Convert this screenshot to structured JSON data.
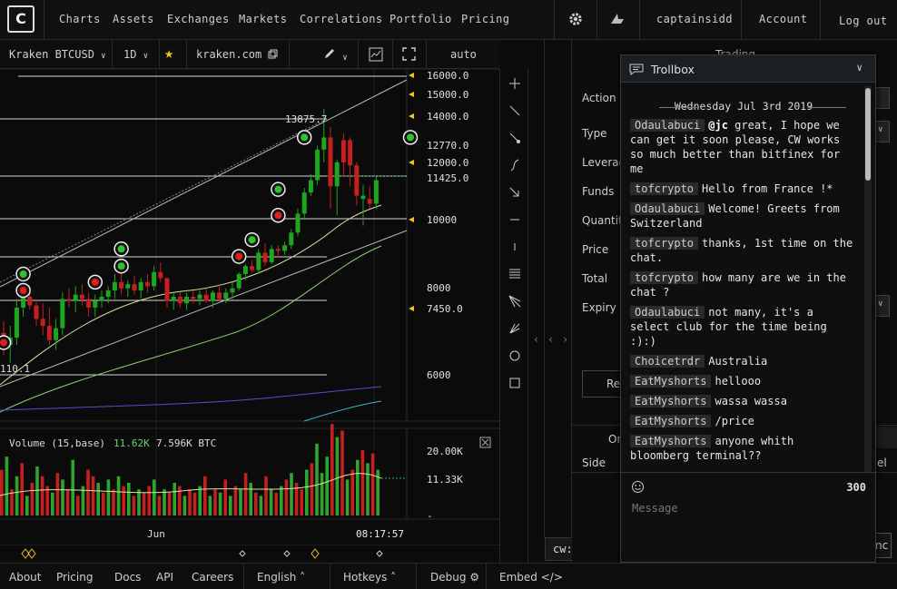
{
  "nav": {
    "logo": "C",
    "links": [
      "Charts",
      "Assets",
      "Exchanges",
      "Markets",
      "Correlations",
      "Portfolio",
      "Pricing"
    ],
    "settings_icon": "gear-icon",
    "alert_icon": "shark-icon",
    "username": "captainsidd",
    "account": "Account",
    "logout": "Log out"
  },
  "chart_toolbar": {
    "market": "Kraken BTCUSD",
    "interval": "1D",
    "source": "kraken.com",
    "scale_mode": "auto"
  },
  "chart_data": [
    {
      "type": "candlestick",
      "title": "",
      "price_labels": [
        "16000.0",
        "15000.0",
        "14000.0",
        "12770.0",
        "12000.0",
        "11425.0",
        "10000",
        "8000",
        "7450.0",
        "6000"
      ],
      "annotations": [
        "13875.7",
        "110.1"
      ],
      "x_tick": "Jun",
      "time": "08:17:57",
      "candles": [
        {
          "o": 7150,
          "h": 7400,
          "l": 6700,
          "c": 6900,
          "up": false
        },
        {
          "o": 6900,
          "h": 7300,
          "l": 6550,
          "c": 7050,
          "up": true
        },
        {
          "o": 7050,
          "h": 7900,
          "l": 6900,
          "c": 7700,
          "up": true
        },
        {
          "o": 7700,
          "h": 8250,
          "l": 7500,
          "c": 7950,
          "up": true
        },
        {
          "o": 7950,
          "h": 8200,
          "l": 7650,
          "c": 7750,
          "up": false
        },
        {
          "o": 7750,
          "h": 7900,
          "l": 7300,
          "c": 7450,
          "up": false
        },
        {
          "o": 7450,
          "h": 7800,
          "l": 7100,
          "c": 7300,
          "up": false
        },
        {
          "o": 7300,
          "h": 7700,
          "l": 6900,
          "c": 7000,
          "up": false
        },
        {
          "o": 7000,
          "h": 7450,
          "l": 6800,
          "c": 7250,
          "up": true
        },
        {
          "o": 7250,
          "h": 8050,
          "l": 7100,
          "c": 7900,
          "up": true
        },
        {
          "o": 7900,
          "h": 8150,
          "l": 7700,
          "c": 7850,
          "up": false
        },
        {
          "o": 7850,
          "h": 8200,
          "l": 7600,
          "c": 8000,
          "up": true
        },
        {
          "o": 8000,
          "h": 8250,
          "l": 7750,
          "c": 7900,
          "up": false
        },
        {
          "o": 7900,
          "h": 8050,
          "l": 7500,
          "c": 7700,
          "up": false
        },
        {
          "o": 7700,
          "h": 8000,
          "l": 7500,
          "c": 7850,
          "up": true
        },
        {
          "o": 7850,
          "h": 8100,
          "l": 7700,
          "c": 7950,
          "up": true
        },
        {
          "o": 7950,
          "h": 8200,
          "l": 7800,
          "c": 8100,
          "up": true
        },
        {
          "o": 8100,
          "h": 8500,
          "l": 7900,
          "c": 8300,
          "up": true
        },
        {
          "o": 8300,
          "h": 8600,
          "l": 8000,
          "c": 8150,
          "up": false
        },
        {
          "o": 8150,
          "h": 8350,
          "l": 7950,
          "c": 8250,
          "up": true
        },
        {
          "o": 8250,
          "h": 8450,
          "l": 8000,
          "c": 8100,
          "up": false
        },
        {
          "o": 8100,
          "h": 8400,
          "l": 7900,
          "c": 8300,
          "up": true
        },
        {
          "o": 8300,
          "h": 8500,
          "l": 8050,
          "c": 8200,
          "up": false
        },
        {
          "o": 8200,
          "h": 8700,
          "l": 8100,
          "c": 8550,
          "up": true
        },
        {
          "o": 8550,
          "h": 8800,
          "l": 8300,
          "c": 8400,
          "up": false
        },
        {
          "o": 8400,
          "h": 8400,
          "l": 7700,
          "c": 7850,
          "up": false
        },
        {
          "o": 7850,
          "h": 8050,
          "l": 7650,
          "c": 7950,
          "up": true
        },
        {
          "o": 7950,
          "h": 8050,
          "l": 7700,
          "c": 7800,
          "up": false
        },
        {
          "o": 7800,
          "h": 8050,
          "l": 7650,
          "c": 7950,
          "up": true
        },
        {
          "o": 7950,
          "h": 8100,
          "l": 7800,
          "c": 7900,
          "up": false
        },
        {
          "o": 7900,
          "h": 8100,
          "l": 7750,
          "c": 8000,
          "up": true
        },
        {
          "o": 8000,
          "h": 8150,
          "l": 7800,
          "c": 7850,
          "up": false
        },
        {
          "o": 7850,
          "h": 8100,
          "l": 7700,
          "c": 8050,
          "up": true
        },
        {
          "o": 8050,
          "h": 8250,
          "l": 7850,
          "c": 7900,
          "up": false
        },
        {
          "o": 7900,
          "h": 8150,
          "l": 7800,
          "c": 8050,
          "up": true
        },
        {
          "o": 8050,
          "h": 8300,
          "l": 7900,
          "c": 8150,
          "up": true
        },
        {
          "o": 8150,
          "h": 8550,
          "l": 8100,
          "c": 8500,
          "up": true
        },
        {
          "o": 8500,
          "h": 8750,
          "l": 8350,
          "c": 8700,
          "up": true
        },
        {
          "o": 8700,
          "h": 8850,
          "l": 8550,
          "c": 8600,
          "up": false
        },
        {
          "o": 8600,
          "h": 9150,
          "l": 8500,
          "c": 9050,
          "up": true
        },
        {
          "o": 9050,
          "h": 9300,
          "l": 8700,
          "c": 8800,
          "up": false
        },
        {
          "o": 8800,
          "h": 9250,
          "l": 8750,
          "c": 9150,
          "up": true
        },
        {
          "o": 9150,
          "h": 9250,
          "l": 8900,
          "c": 9100,
          "up": false
        },
        {
          "o": 9100,
          "h": 9350,
          "l": 9000,
          "c": 9250,
          "up": true
        },
        {
          "o": 9250,
          "h": 9700,
          "l": 9150,
          "c": 9600,
          "up": true
        },
        {
          "o": 9600,
          "h": 10300,
          "l": 9500,
          "c": 10150,
          "up": true
        },
        {
          "o": 10150,
          "h": 10950,
          "l": 10000,
          "c": 10800,
          "up": true
        },
        {
          "o": 10800,
          "h": 11400,
          "l": 10700,
          "c": 11200,
          "up": true
        },
        {
          "o": 11200,
          "h": 12400,
          "l": 11050,
          "c": 12250,
          "up": true
        },
        {
          "o": 12250,
          "h": 13800,
          "l": 11800,
          "c": 12700,
          "up": true
        },
        {
          "o": 12700,
          "h": 13100,
          "l": 10300,
          "c": 11000,
          "up": false
        },
        {
          "o": 11000,
          "h": 11900,
          "l": 10100,
          "c": 11800,
          "up": true
        },
        {
          "o": 11800,
          "h": 12850,
          "l": 11300,
          "c": 12600,
          "up": false
        },
        {
          "o": 12600,
          "h": 12700,
          "l": 11000,
          "c": 11700,
          "up": false
        },
        {
          "o": 11700,
          "h": 11800,
          "l": 10400,
          "c": 10700,
          "up": false
        },
        {
          "o": 10700,
          "h": 11050,
          "l": 9800,
          "c": 10600,
          "up": true
        },
        {
          "o": 10600,
          "h": 11000,
          "l": 10300,
          "c": 10450,
          "up": false
        },
        {
          "o": 10450,
          "h": 11300,
          "l": 10300,
          "c": 11200,
          "up": true
        }
      ],
      "markers": [
        {
          "i": 0,
          "p": 6950,
          "kind": "sell"
        },
        {
          "i": 3,
          "p": 8100,
          "kind": "sell"
        },
        {
          "i": 3,
          "p": 8500,
          "kind": "buy"
        },
        {
          "i": 14,
          "p": 8300,
          "kind": "sell"
        },
        {
          "i": 18,
          "p": 9150,
          "kind": "buy"
        },
        {
          "i": 18,
          "p": 8700,
          "kind": "buy"
        },
        {
          "i": 36,
          "p": 8950,
          "kind": "sell"
        },
        {
          "i": 38,
          "p": 9400,
          "kind": "buy"
        },
        {
          "i": 42,
          "p": 10100,
          "kind": "sell"
        },
        {
          "i": 42,
          "p": 10900,
          "kind": "buy"
        },
        {
          "i": 46,
          "p": 12700,
          "kind": "buy"
        },
        {
          "i": 58,
          "p": 12700,
          "kind": "buy"
        }
      ]
    },
    {
      "type": "bar",
      "title": "Volume (15,base)",
      "legend_value_1": "11.62K",
      "legend_value_2": "7.596K BTC",
      "y_labels": [
        "20.00K",
        "11.33K",
        "-"
      ],
      "values": [
        14,
        18,
        8,
        12,
        16,
        6,
        10,
        15,
        12,
        9,
        7,
        13,
        11,
        8,
        17,
        6,
        9,
        14,
        12,
        10,
        7,
        11,
        8,
        12,
        9,
        10,
        6,
        8,
        7,
        9,
        11,
        6,
        8,
        7,
        10,
        9,
        6,
        8,
        7,
        9,
        12,
        6,
        8,
        7,
        11,
        6,
        9,
        8,
        13,
        10,
        7,
        6,
        12,
        8,
        7,
        9,
        11,
        13,
        10,
        8,
        14,
        16,
        22,
        13,
        18,
        28,
        24,
        26,
        11,
        14,
        17,
        20,
        16,
        19,
        14
      ],
      "colors": [
        "r",
        "g",
        "r",
        "g",
        "r",
        "g",
        "r",
        "g",
        "r",
        "r",
        "g",
        "r",
        "g",
        "r",
        "g",
        "r",
        "g",
        "r",
        "r",
        "g",
        "r",
        "g",
        "r",
        "g",
        "r",
        "g",
        "r",
        "g",
        "r",
        "r",
        "g",
        "r",
        "g",
        "r",
        "g",
        "r",
        "g",
        "r",
        "r",
        "g",
        "r",
        "g",
        "r",
        "g",
        "r",
        "g",
        "r",
        "g",
        "r",
        "g",
        "r",
        "g",
        "r",
        "g",
        "r",
        "g",
        "r",
        "g",
        "r",
        "r",
        "g",
        "r",
        "g",
        "g",
        "g",
        "r",
        "g",
        "r",
        "g",
        "r",
        "g",
        "r",
        "g",
        "r",
        "g"
      ]
    }
  ],
  "trading_panel": {
    "title": "Trading",
    "labels": [
      "Action",
      "Type",
      "Leverag",
      "Funds",
      "Quantit",
      "Price",
      "Total",
      "Expiry"
    ],
    "reset_fragment": "Re",
    "orders_fragment": "Or",
    "side_label": "Side",
    "side_fragment_right": "el",
    "cancel_fragment": "nc"
  },
  "cw_label": "cw:",
  "trollbox": {
    "title": "Trollbox",
    "date": "Wednesday Jul 3rd 2019",
    "messages": [
      {
        "user": "Odaulabuci",
        "mention": "@jc",
        "text": " great, I hope we can get it soon please, CW works so much better than bitfinex for me"
      },
      {
        "user": "tofcrypto",
        "mention": "",
        "text": "Hello from France !*"
      },
      {
        "user": "Odaulabuci",
        "mention": "",
        "text": "Welcome! Greets from Switzerland"
      },
      {
        "user": "tofcrypto",
        "mention": "",
        "text": "thanks, 1st time on the chat."
      },
      {
        "user": "tofcrypto",
        "mention": "",
        "text": "how many are we in the chat ?"
      },
      {
        "user": "Odaulabuci",
        "mention": "",
        "text": "not many, it's a select club for the time being :):)"
      },
      {
        "user": "Choicetrdr",
        "mention": "",
        "text": "Australia"
      },
      {
        "user": "EatMyshorts",
        "mention": "",
        "text": "hellooo"
      },
      {
        "user": "EatMyshorts",
        "mention": "",
        "text": "wassa wassa"
      },
      {
        "user": "EatMyshorts",
        "mention": "",
        "text": "/price"
      },
      {
        "user": "EatMyshorts",
        "mention": "",
        "text": "anyone whith bloomberg terminal??"
      }
    ],
    "char_count": "300",
    "message_placeholder": "Message"
  },
  "footer": {
    "links": [
      "About",
      "Pricing",
      "Docs",
      "API",
      "Careers"
    ],
    "language": "English",
    "hotkeys": "Hotkeys",
    "debug": "Debug",
    "embed": "Embed"
  },
  "colors": {
    "up": "#1fa51f",
    "down": "#c51f1f",
    "accent": "#f0c419",
    "ma_yellow": "#d8e4a0",
    "ma_green": "#8ed36a",
    "ma_blue": "#4a55c8",
    "ma_cyan": "#3fb6c9"
  }
}
